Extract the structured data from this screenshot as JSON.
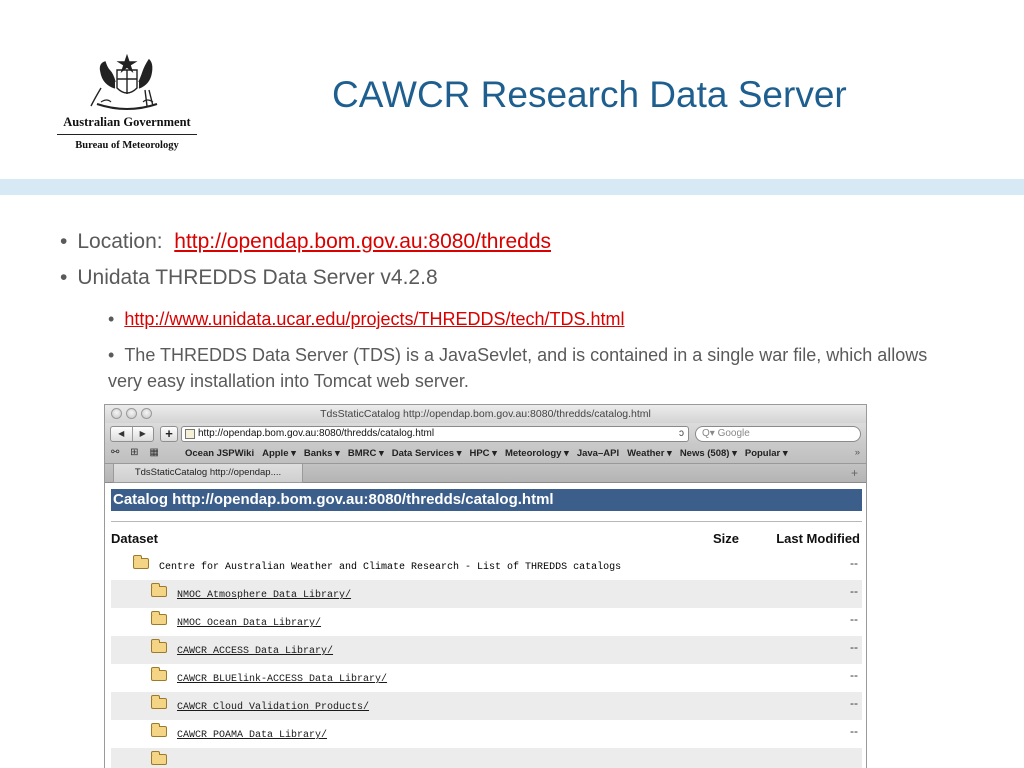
{
  "slide": {
    "title": "CAWCR Research Data Server",
    "logo": {
      "government": "Australian Government",
      "bureau": "Bureau of Meteorology"
    },
    "bullets": {
      "location_label": "Location:",
      "location_link": "http://opendap.bom.gov.au:8080/thredds",
      "server_version": "Unidata THREDDS Data Server v4.2.8",
      "sub_link": "http://www.unidata.ucar.edu/projects/THREDDS/tech/TDS.html",
      "description": "The THREDDS Data Server (TDS) is a JavaSevlet, and is contained in a single war file, which allows very easy installation into Tomcat web server."
    }
  },
  "browser": {
    "window_title": "TdsStaticCatalog http://opendap.bom.gov.au:8080/thredds/catalog.html",
    "nav": {
      "back": "◀",
      "forward": "▶",
      "add": "+"
    },
    "url": "http://opendap.bom.gov.au:8080/thredds/catalog.html",
    "reload_glyph": "ↄ",
    "search_placeholder": "Q▾ Google",
    "bookmark_icons": "⚯ ⊞ ▦",
    "bookmarks": [
      "Ocean JSPWiki",
      "Apple ▾",
      "Banks ▾",
      "BMRC ▾",
      "Data Services ▾",
      "HPC ▾",
      "Meteorology ▾",
      "Java–API",
      "Weather ▾",
      "News (508) ▾",
      "Popular ▾"
    ],
    "bookmarks_more": "»",
    "tab_label": "TdsStaticCatalog http://opendap....",
    "new_tab": "+"
  },
  "catalog": {
    "heading": "Catalog http://opendap.bom.gov.au:8080/thredds/catalog.html",
    "columns": {
      "dataset": "Dataset",
      "size": "Size",
      "last_modified": "Last Modified"
    },
    "rows": [
      {
        "name": "Centre for Australian Weather and Climate Research - List of THREDDS catalogs",
        "level": 0,
        "linked": false,
        "last_modified": "--"
      },
      {
        "name": "NMOC Atmosphere Data Library/",
        "level": 1,
        "linked": true,
        "last_modified": "--"
      },
      {
        "name": "NMOC Ocean Data Library/",
        "level": 1,
        "linked": true,
        "last_modified": "--"
      },
      {
        "name": "CAWCR ACCESS Data Library/",
        "level": 1,
        "linked": true,
        "last_modified": "--"
      },
      {
        "name": "CAWCR BLUElink-ACCESS Data Library/",
        "level": 1,
        "linked": true,
        "last_modified": "--"
      },
      {
        "name": "CAWCR Cloud Validation Products/",
        "level": 1,
        "linked": true,
        "last_modified": "--"
      },
      {
        "name": "CAWCR POAMA Data Library/",
        "level": 1,
        "linked": true,
        "last_modified": "--"
      },
      {
        "name": "",
        "level": 1,
        "linked": false,
        "last_modified": ""
      }
    ]
  }
}
